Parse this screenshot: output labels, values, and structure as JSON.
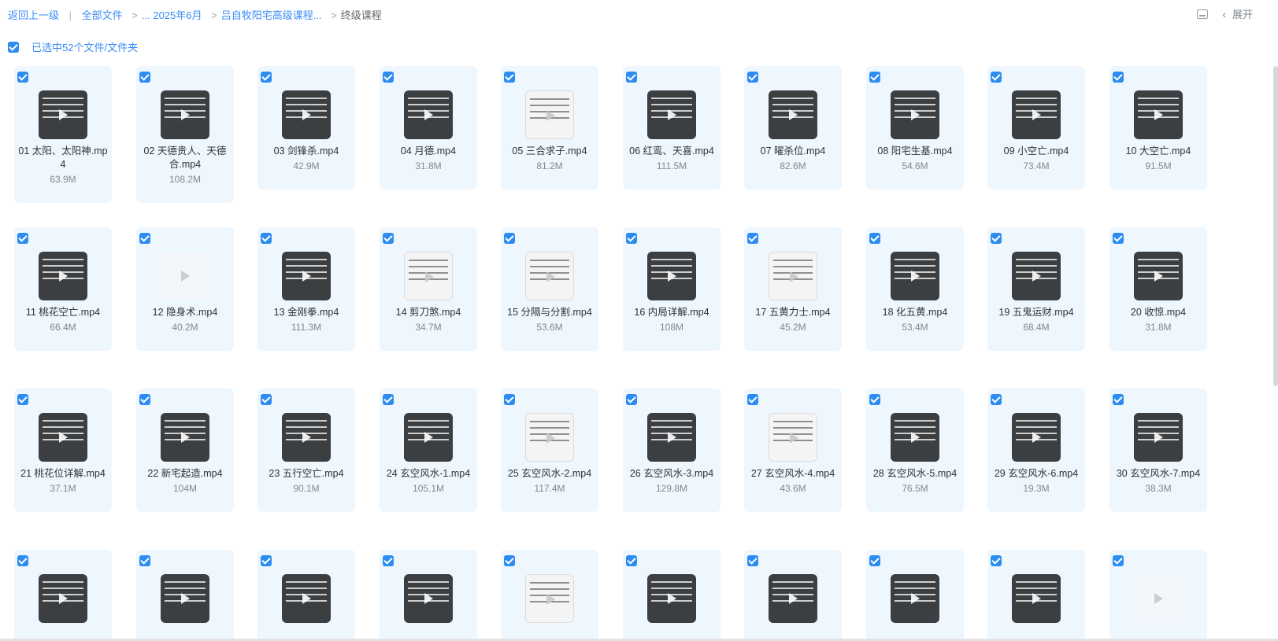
{
  "breadcrumb": {
    "back": "返回上一级",
    "all_files": "全部文件",
    "path1": "... 2025年6月",
    "path2": "吕自牧阳宅高级课程...",
    "current": "终级课程"
  },
  "toolbar": {
    "expand_label": "展开"
  },
  "selection": {
    "text": "已选中52个文件/文件夹"
  },
  "files": [
    {
      "name": "01 太阳、太阳神.mp4",
      "size": "63.9M",
      "thumb": "dark"
    },
    {
      "name": "02 天德贵人、天德合.mp4",
      "size": "108.2M",
      "thumb": "dark"
    },
    {
      "name": "03 剑锋杀.mp4",
      "size": "42.9M",
      "thumb": "dark"
    },
    {
      "name": "04 月德.mp4",
      "size": "31.8M",
      "thumb": "dark"
    },
    {
      "name": "05 三合求子.mp4",
      "size": "81.2M",
      "thumb": "light"
    },
    {
      "name": "06 红鸾、天喜.mp4",
      "size": "111.5M",
      "thumb": "dark"
    },
    {
      "name": "07 曜杀位.mp4",
      "size": "82.6M",
      "thumb": "dark"
    },
    {
      "name": "08 阳宅生基.mp4",
      "size": "54.6M",
      "thumb": "dark"
    },
    {
      "name": "09 小空亡.mp4",
      "size": "73.4M",
      "thumb": "dark"
    },
    {
      "name": "10 大空亡.mp4",
      "size": "91.5M",
      "thumb": "dark"
    },
    {
      "name": "11 桃花空亡.mp4",
      "size": "66.4M",
      "thumb": "dark"
    },
    {
      "name": "12 隐身术.mp4",
      "size": "40.2M",
      "thumb": "faint"
    },
    {
      "name": "13 金刚拳.mp4",
      "size": "111.3M",
      "thumb": "dark"
    },
    {
      "name": "14 剪刀煞.mp4",
      "size": "34.7M",
      "thumb": "light"
    },
    {
      "name": "15 分隔与分割.mp4",
      "size": "53.6M",
      "thumb": "light"
    },
    {
      "name": "16 内局详解.mp4",
      "size": "108M",
      "thumb": "dark"
    },
    {
      "name": "17 五黄力士.mp4",
      "size": "45.2M",
      "thumb": "light"
    },
    {
      "name": "18 化五黄.mp4",
      "size": "53.4M",
      "thumb": "dark"
    },
    {
      "name": "19 五鬼运财.mp4",
      "size": "68.4M",
      "thumb": "dark"
    },
    {
      "name": "20 收惊.mp4",
      "size": "31.8M",
      "thumb": "dark"
    },
    {
      "name": "21 桃花位详解.mp4",
      "size": "37.1M",
      "thumb": "dark"
    },
    {
      "name": "22 新宅起造.mp4",
      "size": "104M",
      "thumb": "dark"
    },
    {
      "name": "23 五行空亡.mp4",
      "size": "90.1M",
      "thumb": "dark"
    },
    {
      "name": "24 玄空风水-1.mp4",
      "size": "105.1M",
      "thumb": "dark"
    },
    {
      "name": "25 玄空风水-2.mp4",
      "size": "117.4M",
      "thumb": "light"
    },
    {
      "name": "26 玄空风水-3.mp4",
      "size": "129.8M",
      "thumb": "dark"
    },
    {
      "name": "27 玄空风水-4.mp4",
      "size": "43.6M",
      "thumb": "light"
    },
    {
      "name": "28 玄空风水-5.mp4",
      "size": "76.5M",
      "thumb": "dark"
    },
    {
      "name": "29 玄空风水-6.mp4",
      "size": "19.3M",
      "thumb": "dark"
    },
    {
      "name": "30 玄空风水-7.mp4",
      "size": "38.3M",
      "thumb": "dark"
    },
    {
      "name": "",
      "size": "",
      "thumb": "dark"
    },
    {
      "name": "",
      "size": "",
      "thumb": "dark"
    },
    {
      "name": "",
      "size": "",
      "thumb": "dark"
    },
    {
      "name": "",
      "size": "",
      "thumb": "dark"
    },
    {
      "name": "",
      "size": "",
      "thumb": "light"
    },
    {
      "name": "",
      "size": "",
      "thumb": "dark"
    },
    {
      "name": "",
      "size": "",
      "thumb": "dark"
    },
    {
      "name": "",
      "size": "",
      "thumb": "dark"
    },
    {
      "name": "",
      "size": "",
      "thumb": "dark"
    },
    {
      "name": "",
      "size": "",
      "thumb": "faint"
    }
  ]
}
